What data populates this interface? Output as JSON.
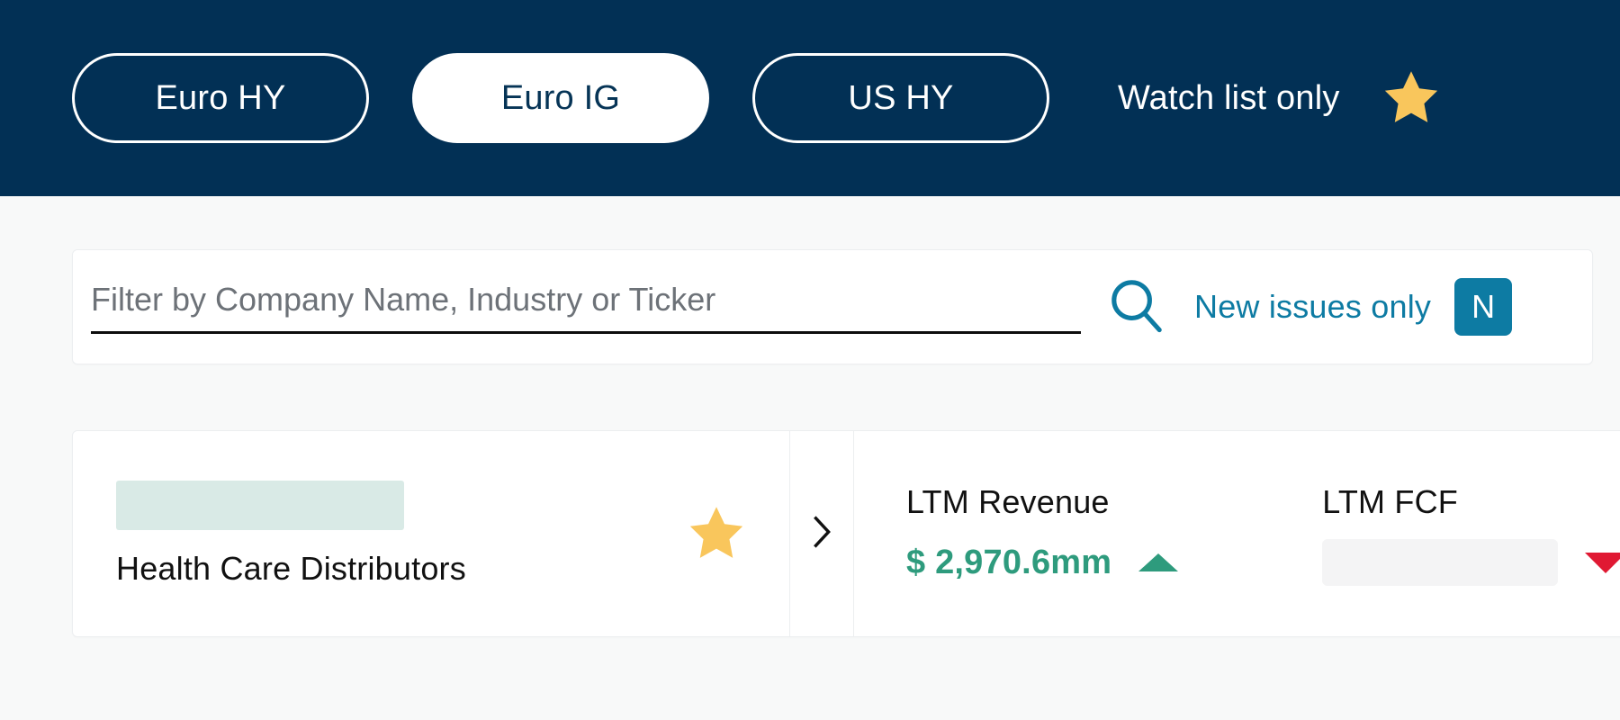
{
  "topbar": {
    "tabs": [
      {
        "label": "Euro HY",
        "active": false
      },
      {
        "label": "Euro IG",
        "active": true
      },
      {
        "label": "US HY",
        "active": false
      }
    ],
    "watch_list_label": "Watch list only",
    "watch_star_icon": "star-icon",
    "background_color": "#023055",
    "star_color": "#f9c65c"
  },
  "search": {
    "value": "",
    "placeholder": "Filter by Company Name, Industry or Ticker",
    "search_icon": "search-icon",
    "new_issues_label": "New issues only",
    "new_issues_badge": "N",
    "accent_color": "#0d7ba3"
  },
  "results": [
    {
      "company_name": "",
      "industry": "Health Care Distributors",
      "starred": true,
      "star_color": "#f9c65c",
      "expand_icon": "chevron-right-icon",
      "metrics": [
        {
          "label": "LTM Revenue",
          "value": "$ 2,970.6mm",
          "trend": "up",
          "trend_color": "#2e9b7d",
          "redacted": false
        },
        {
          "label": "LTM FCF",
          "value": "",
          "trend": "down",
          "trend_color": "#e01933",
          "redacted": true
        }
      ]
    }
  ]
}
